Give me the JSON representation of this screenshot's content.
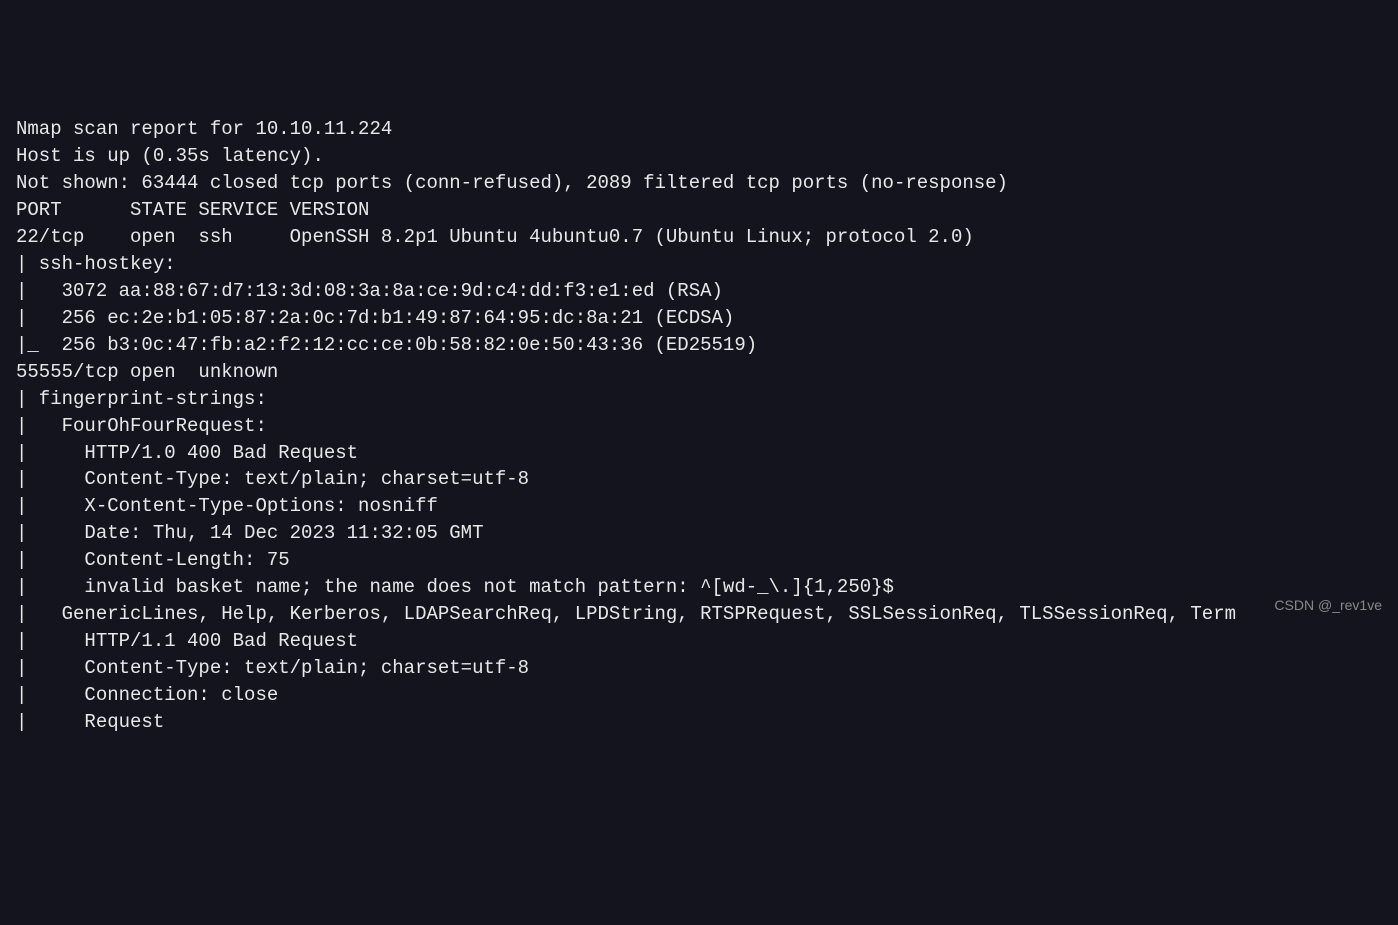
{
  "terminal": {
    "lines": [
      "Nmap scan report for 10.10.11.224",
      "Host is up (0.35s latency).",
      "Not shown: 63444 closed tcp ports (conn-refused), 2089 filtered tcp ports (no-response)",
      "PORT      STATE SERVICE VERSION",
      "22/tcp    open  ssh     OpenSSH 8.2p1 Ubuntu 4ubuntu0.7 (Ubuntu Linux; protocol 2.0)",
      "| ssh-hostkey: ",
      "|   3072 aa:88:67:d7:13:3d:08:3a:8a:ce:9d:c4:dd:f3:e1:ed (RSA)",
      "|   256 ec:2e:b1:05:87:2a:0c:7d:b1:49:87:64:95:dc:8a:21 (ECDSA)",
      "|_  256 b3:0c:47:fb:a2:f2:12:cc:ce:0b:58:82:0e:50:43:36 (ED25519)",
      "55555/tcp open  unknown",
      "| fingerprint-strings: ",
      "|   FourOhFourRequest: ",
      "|     HTTP/1.0 400 Bad Request",
      "|     Content-Type: text/plain; charset=utf-8",
      "|     X-Content-Type-Options: nosniff",
      "|     Date: Thu, 14 Dec 2023 11:32:05 GMT",
      "|     Content-Length: 75",
      "|     invalid basket name; the name does not match pattern: ^[wd-_\\.]{1,250}$",
      "|   GenericLines, Help, Kerberos, LDAPSearchReq, LPDString, RTSPRequest, SSLSessionReq, TLSSessionReq, Term",
      "|     HTTP/1.1 400 Bad Request",
      "|     Content-Type: text/plain; charset=utf-8",
      "|     Connection: close",
      "|     Request"
    ]
  },
  "watermark": "CSDN @_rev1ve"
}
